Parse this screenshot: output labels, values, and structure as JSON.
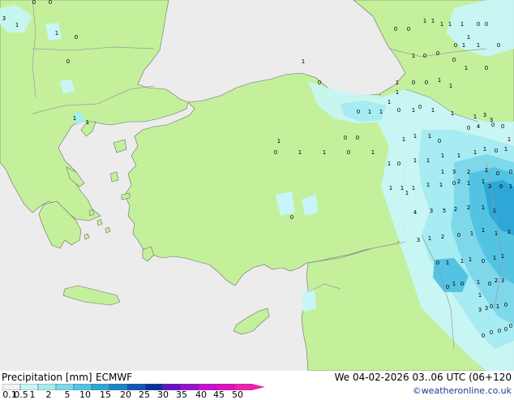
{
  "title": "Precipitation [mm]",
  "model": "ECMWF",
  "datetime": "We 04-02-2026 03..06 UTC (06+120",
  "credit": "©weatheronline.co.uk",
  "legend": {
    "ticks": [
      "0.1",
      "0.5",
      "1",
      "2",
      "5",
      "10",
      "15",
      "20",
      "25",
      "30",
      "35",
      "40",
      "45",
      "50"
    ],
    "colors": [
      "#f2f2f2",
      "#c8f6f8",
      "#a6ecf2",
      "#7ed8ea",
      "#52c4e2",
      "#2ea7d8",
      "#1a86c8",
      "#1057b8",
      "#0a2ea0",
      "#6a10c8",
      "#9a10d0",
      "#c810d0",
      "#e010c0",
      "#f020b0"
    ]
  },
  "map": {
    "colors": {
      "sea": "#ececec",
      "land": "#c4f09c",
      "border": "#9a9a9a",
      "coast": "#6a6a6a"
    },
    "values": [
      "0",
      "0",
      "3",
      "1",
      "1",
      "0",
      "0",
      "1",
      "1",
      "1",
      "1",
      "1",
      "1",
      "1",
      "0",
      "0",
      "0",
      "0",
      "1",
      "0",
      "1",
      "1",
      "0",
      "1",
      "0",
      "0",
      "0",
      "1",
      "0",
      "1",
      "0",
      "1",
      "0",
      "0",
      "1",
      "1",
      "1",
      "1",
      "0",
      "1",
      "0",
      "1",
      "0",
      "1",
      "1",
      "1",
      "1",
      "3",
      "3",
      "0",
      "4",
      "0",
      "0",
      "0",
      "0",
      "1",
      "1",
      "1",
      "0",
      "1",
      "0",
      "1",
      "1",
      "1",
      "1",
      "1",
      "1",
      "0",
      "1",
      "1",
      "1",
      "3",
      "2",
      "1",
      "0",
      "0",
      "1",
      "1",
      "1",
      "1",
      "1",
      "0",
      "2",
      "1",
      "1",
      "3",
      "0",
      "1",
      "1",
      "4",
      "3",
      "5",
      "2",
      "2",
      "1",
      "1",
      "3",
      "1",
      "2",
      "0",
      "1",
      "1",
      "1",
      "1",
      "0",
      "1",
      "1",
      "1",
      "0",
      "1",
      "1",
      "1",
      "0",
      "1",
      "0",
      "2",
      "3",
      "3",
      "3",
      "0",
      "1",
      "0",
      "0",
      "0",
      "0",
      "0",
      "0",
      "0",
      "0",
      "1",
      "1",
      "0",
      "1",
      "1",
      "0",
      "1"
    ]
  }
}
